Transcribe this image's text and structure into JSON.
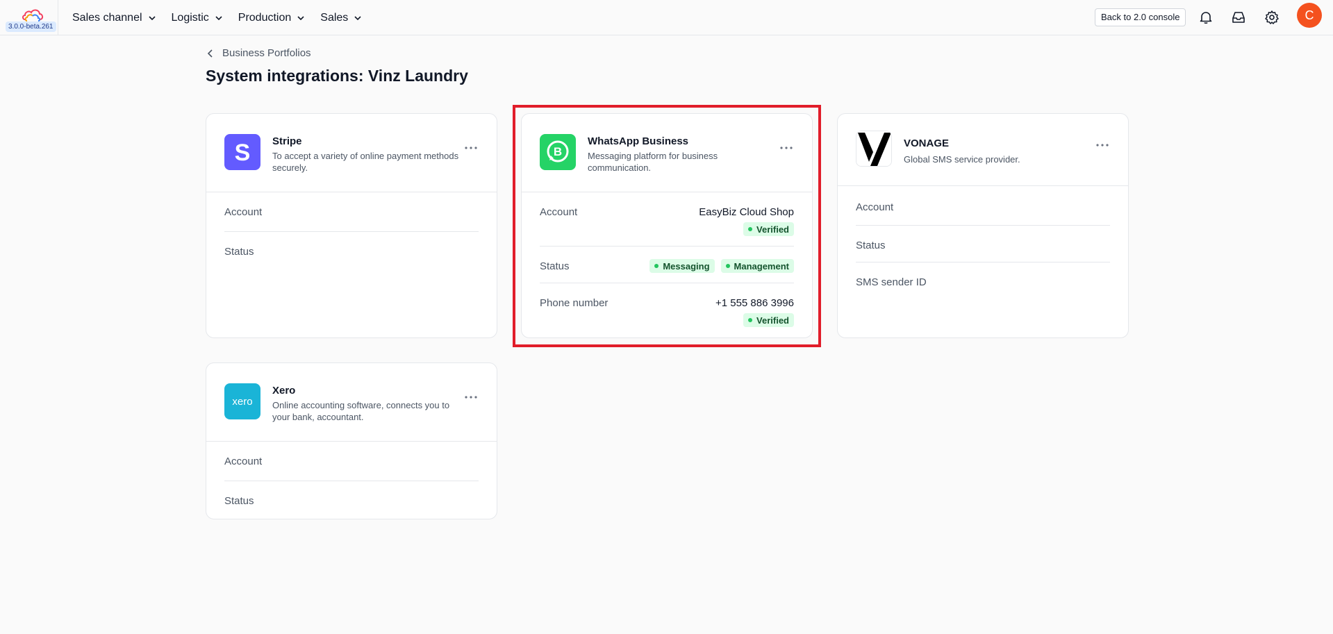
{
  "app": {
    "version": "3.0.0-beta.261",
    "nav": [
      {
        "label": "Sales channel"
      },
      {
        "label": "Logistic"
      },
      {
        "label": "Production"
      },
      {
        "label": "Sales"
      }
    ],
    "console_button": "Back to 2.0 console",
    "avatar_initial": "C"
  },
  "page": {
    "breadcrumb": "Business Portfolios",
    "title": "System integrations: Vinz Laundry"
  },
  "cards": {
    "stripe": {
      "name": "Stripe",
      "description": "To accept a variety of online payment methods securely.",
      "rows": [
        {
          "label": "Account"
        },
        {
          "label": "Status"
        }
      ]
    },
    "whatsapp": {
      "name": "WhatsApp Business",
      "description": "Messaging platform for business communication.",
      "account_label": "Account",
      "account_value": "EasyBiz Cloud Shop",
      "account_badge": "Verified",
      "status_label": "Status",
      "status_badges": [
        "Messaging",
        "Management"
      ],
      "phone_label": "Phone number",
      "phone_value": "+1 555 886 3996",
      "phone_badge": "Verified"
    },
    "vonage": {
      "name": "VONAGE",
      "description": "Global SMS service provider.",
      "rows": [
        {
          "label": "Account"
        },
        {
          "label": "Status"
        },
        {
          "label": "SMS sender ID"
        }
      ]
    },
    "xero": {
      "name": "Xero",
      "logo_text": "xero",
      "description": "Online accounting software, connects you to your bank, accountant.",
      "rows": [
        {
          "label": "Account"
        },
        {
          "label": "Status"
        }
      ]
    }
  },
  "colors": {
    "stripe": "#635bff",
    "whatsapp": "#25d366",
    "xero": "#1ab4d7",
    "verified_badge_bg": "#dcfce7",
    "highlight": "#e11d2a",
    "avatar": "#f4511e"
  }
}
